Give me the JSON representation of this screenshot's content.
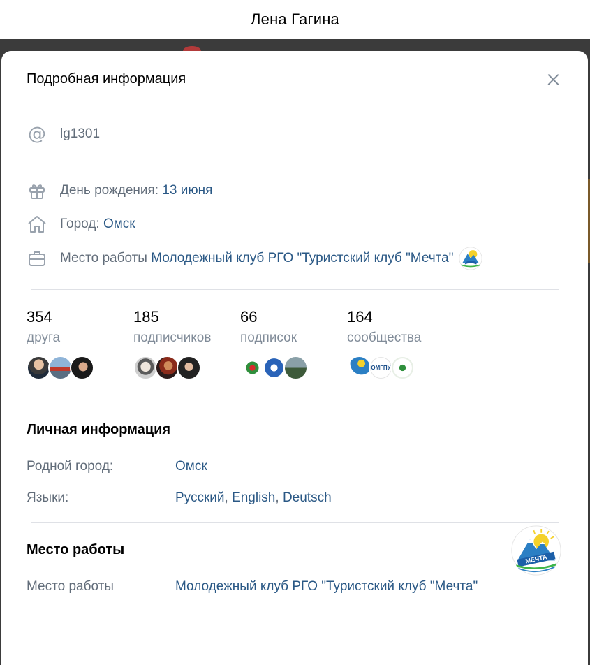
{
  "topbar": {
    "name": "Лена Гагина"
  },
  "modal": {
    "title": "Подробная информация",
    "username": "lg1301",
    "birthday": {
      "label": "День рождения:",
      "value": "13 июня"
    },
    "city": {
      "label": "Город:",
      "value": "Омск"
    },
    "work": {
      "label": "Место работы",
      "value": "Молодежный клуб РГО \"Туристский клуб \"Мечта\""
    },
    "stats": [
      {
        "count": "354",
        "label": "друга",
        "avatars": [
          "friend-1",
          "friend-2",
          "friend-3"
        ]
      },
      {
        "count": "185",
        "label": "подписчиков",
        "avatars": [
          "follower-1",
          "follower-2",
          "follower-3"
        ]
      },
      {
        "count": "66",
        "label": "подписок",
        "avatars": [
          "subscription-1",
          "subscription-2",
          "subscription-3"
        ]
      },
      {
        "count": "164",
        "label": "сообщества",
        "avatars": [
          "community-1",
          "community-2",
          "community-3"
        ]
      }
    ],
    "personal": {
      "title": "Личная информация",
      "hometown": {
        "label": "Родной город:",
        "value": "Омск"
      },
      "languages": {
        "label": "Языки:",
        "values": [
          "Русский",
          "English",
          "Deutsch"
        ]
      }
    },
    "career": {
      "title": "Место работы",
      "label": "Место работы",
      "value": "Молодежный клуб РГО \"Туристский клуб \"Мечта\""
    },
    "logo_text": "МЕЧТА",
    "community_abbr": "ОМГПУ"
  },
  "colors": {
    "link": "#2a5885",
    "secondary": "#626d7a",
    "muted": "#818c99",
    "divider": "#dfe1e6",
    "backdrop": "#3b3b3b"
  }
}
